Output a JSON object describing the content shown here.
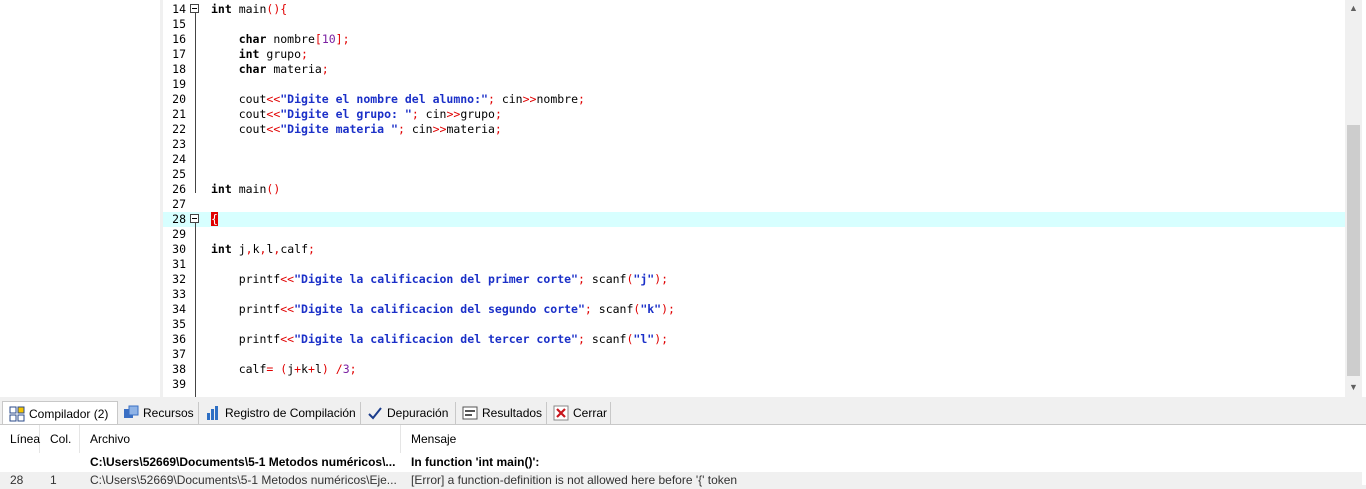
{
  "editor": {
    "lines": [
      {
        "n": "14",
        "fold": true,
        "current": false,
        "tokens": [
          [
            "kw",
            "int"
          ],
          [
            "t",
            " main"
          ],
          [
            "op",
            "(){"
          ]
        ]
      },
      {
        "n": "15",
        "tokens": []
      },
      {
        "n": "16",
        "tokens": [
          [
            "t",
            "    "
          ],
          [
            "kw",
            "char"
          ],
          [
            "t",
            " nombre"
          ],
          [
            "op",
            "["
          ],
          [
            "num",
            "10"
          ],
          [
            "op",
            "];"
          ]
        ]
      },
      {
        "n": "17",
        "tokens": [
          [
            "t",
            "    "
          ],
          [
            "kw",
            "int"
          ],
          [
            "t",
            " grupo"
          ],
          [
            "op",
            ";"
          ]
        ]
      },
      {
        "n": "18",
        "tokens": [
          [
            "t",
            "    "
          ],
          [
            "kw",
            "char"
          ],
          [
            "t",
            " materia"
          ],
          [
            "op",
            ";"
          ]
        ]
      },
      {
        "n": "19",
        "tokens": []
      },
      {
        "n": "20",
        "tokens": [
          [
            "t",
            "    cout"
          ],
          [
            "op",
            "<<"
          ],
          [
            "str",
            "\"Digite el nombre del alumno:\""
          ],
          [
            "op",
            ";"
          ],
          [
            "t",
            " cin"
          ],
          [
            "op",
            ">>"
          ],
          [
            "t",
            "nombre"
          ],
          [
            "op",
            ";"
          ]
        ]
      },
      {
        "n": "21",
        "tokens": [
          [
            "t",
            "    cout"
          ],
          [
            "op",
            "<<"
          ],
          [
            "str",
            "\"Digite el grupo: \""
          ],
          [
            "op",
            ";"
          ],
          [
            "t",
            " cin"
          ],
          [
            "op",
            ">>"
          ],
          [
            "t",
            "grupo"
          ],
          [
            "op",
            ";"
          ]
        ]
      },
      {
        "n": "22",
        "tokens": [
          [
            "t",
            "    cout"
          ],
          [
            "op",
            "<<"
          ],
          [
            "str",
            "\"Digite materia \""
          ],
          [
            "op",
            ";"
          ],
          [
            "t",
            " cin"
          ],
          [
            "op",
            ">>"
          ],
          [
            "t",
            "materia"
          ],
          [
            "op",
            ";"
          ]
        ]
      },
      {
        "n": "23",
        "tokens": []
      },
      {
        "n": "24",
        "tokens": []
      },
      {
        "n": "25",
        "tokens": []
      },
      {
        "n": "26",
        "tokens": [
          [
            "kw",
            "int"
          ],
          [
            "t",
            " main"
          ],
          [
            "op",
            "()"
          ]
        ]
      },
      {
        "n": "27",
        "tokens": []
      },
      {
        "n": "28",
        "fold": true,
        "current": true,
        "tokens": [
          [
            "brkt",
            "{"
          ]
        ]
      },
      {
        "n": "29",
        "tokens": []
      },
      {
        "n": "30",
        "tokens": [
          [
            "kw",
            "int"
          ],
          [
            "t",
            " j"
          ],
          [
            "op",
            ","
          ],
          [
            "t",
            "k"
          ],
          [
            "op",
            ","
          ],
          [
            "t",
            "l"
          ],
          [
            "op",
            ","
          ],
          [
            "t",
            "calf"
          ],
          [
            "op",
            ";"
          ]
        ]
      },
      {
        "n": "31",
        "tokens": []
      },
      {
        "n": "32",
        "tokens": [
          [
            "t",
            "    printf"
          ],
          [
            "op",
            "<<"
          ],
          [
            "str",
            "\"Digite la calificacion del primer corte\""
          ],
          [
            "op",
            ";"
          ],
          [
            "t",
            " scanf"
          ],
          [
            "op",
            "("
          ],
          [
            "str",
            "\"j\""
          ],
          [
            "op",
            ");"
          ]
        ]
      },
      {
        "n": "33",
        "tokens": []
      },
      {
        "n": "34",
        "tokens": [
          [
            "t",
            "    printf"
          ],
          [
            "op",
            "<<"
          ],
          [
            "str",
            "\"Digite la calificacion del segundo corte\""
          ],
          [
            "op",
            ";"
          ],
          [
            "t",
            " scanf"
          ],
          [
            "op",
            "("
          ],
          [
            "str",
            "\"k\""
          ],
          [
            "op",
            ");"
          ]
        ]
      },
      {
        "n": "35",
        "tokens": []
      },
      {
        "n": "36",
        "tokens": [
          [
            "t",
            "    printf"
          ],
          [
            "op",
            "<<"
          ],
          [
            "str",
            "\"Digite la calificacion del tercer corte\""
          ],
          [
            "op",
            ";"
          ],
          [
            "t",
            " scanf"
          ],
          [
            "op",
            "("
          ],
          [
            "str",
            "\"l\""
          ],
          [
            "op",
            ");"
          ]
        ]
      },
      {
        "n": "37",
        "tokens": []
      },
      {
        "n": "38",
        "tokens": [
          [
            "t",
            "    calf"
          ],
          [
            "op",
            "="
          ],
          [
            "t",
            " "
          ],
          [
            "op",
            "("
          ],
          [
            "t",
            "j"
          ],
          [
            "op",
            "+"
          ],
          [
            "t",
            "k"
          ],
          [
            "op",
            "+"
          ],
          [
            "t",
            "l"
          ],
          [
            "op",
            ")"
          ],
          [
            "t",
            " "
          ],
          [
            "op",
            "/"
          ],
          [
            "num",
            "3"
          ],
          [
            "op",
            ";"
          ]
        ]
      },
      {
        "n": "39",
        "tokens": []
      }
    ]
  },
  "scrollbar": {
    "up_icon": "arrow-up-icon",
    "down_icon": "arrow-down-icon"
  },
  "tabs": [
    {
      "label": "Compilador (2)",
      "icon": "compiler-grid-icon",
      "active": true
    },
    {
      "label": "Recursos",
      "icon": "resources-icon"
    },
    {
      "label": "Registro de Compilación",
      "icon": "bar-chart-icon"
    },
    {
      "label": "Depuración",
      "icon": "check-icon"
    },
    {
      "label": "Resultados",
      "icon": "results-icon"
    },
    {
      "label": "Cerrar",
      "icon": "close-icon"
    }
  ],
  "panel": {
    "headers": {
      "line": "Línea",
      "col": "Col.",
      "file": "Archivo",
      "message": "Mensaje"
    },
    "rows": [
      {
        "line": "",
        "col": "",
        "file": "C:\\Users\\52669\\Documents\\5-1 Metodos numéricos\\...",
        "message": "In function 'int main()':",
        "bold": true
      },
      {
        "line": "28",
        "col": "1",
        "file": "C:\\Users\\52669\\Documents\\5-1 Metodos numéricos\\Eje...",
        "message": "[Error] a function-definition is not allowed here before '{' token",
        "bold": false
      }
    ]
  },
  "colors": {
    "current_line": "#d7ffff",
    "string": "#1b30c8",
    "operator": "#e00000",
    "number": "#7a1fa2"
  }
}
